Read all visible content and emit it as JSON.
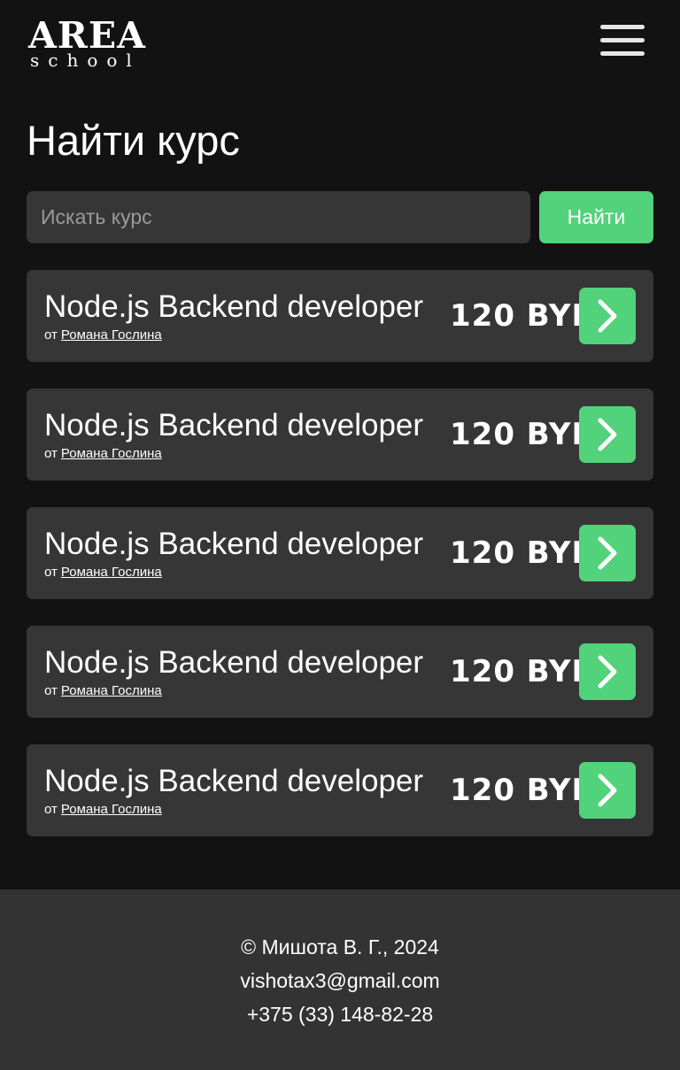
{
  "header": {
    "logo_main": "AREA",
    "logo_sub": "school",
    "menu_icon": "hamburger-menu-icon"
  },
  "main": {
    "title": "Найти курс",
    "search": {
      "placeholder": "Искать курс",
      "value": "",
      "button_label": "Найти"
    },
    "courses": [
      {
        "title": "Node.js Backend developer",
        "author_prefix": "от",
        "author": "Романа Гослина",
        "price": "120 BYN",
        "action_icon": "chevron-right-icon"
      },
      {
        "title": "Node.js Backend developer",
        "author_prefix": "от",
        "author": "Романа Гослина",
        "price": "120 BYN",
        "action_icon": "chevron-right-icon"
      },
      {
        "title": "Node.js Backend developer",
        "author_prefix": "от",
        "author": "Романа Гослина",
        "price": "120 BYN",
        "action_icon": "chevron-right-icon"
      },
      {
        "title": "Node.js Backend developer",
        "author_prefix": "от",
        "author": "Романа Гослина",
        "price": "120 BYN",
        "action_icon": "chevron-right-icon"
      },
      {
        "title": "Node.js Backend developer",
        "author_prefix": "от",
        "author": "Романа Гослина",
        "price": "120 BYN",
        "action_icon": "chevron-right-icon"
      }
    ]
  },
  "footer": {
    "copyright": "© Мишота В. Г., 2024",
    "email": "vishotax3@gmail.com",
    "phone": "+375 (33) 148-82-28"
  },
  "colors": {
    "background": "#121212",
    "card": "#363636",
    "accent": "#52d27a",
    "footer": "#333333",
    "text": "#ffffff"
  }
}
